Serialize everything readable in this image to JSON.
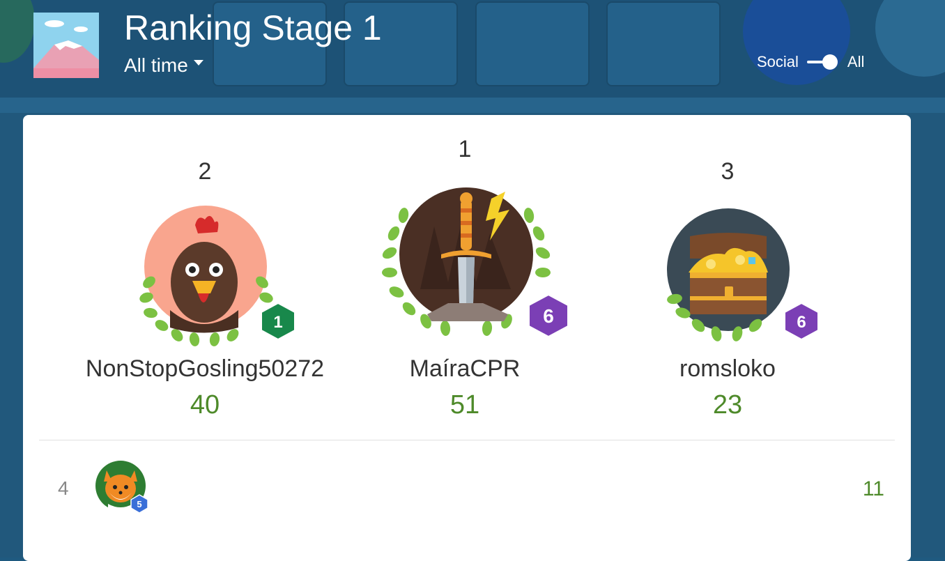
{
  "header": {
    "title": "Ranking Stage 1",
    "filter_label": "All time",
    "toggle_left_label": "Social",
    "toggle_right_label": "All",
    "toggle_state": "All"
  },
  "podium": [
    {
      "rank": "2",
      "name": "NonStopGosling50272",
      "score": "40",
      "level": "1",
      "badge_color": "#18884b",
      "avatar": "rooster-avatar"
    },
    {
      "rank": "1",
      "name": "MaíraCPR",
      "score": "51",
      "level": "6",
      "badge_color": "#7b3fb5",
      "avatar": "sword-avatar"
    },
    {
      "rank": "3",
      "name": "romsloko",
      "score": "23",
      "level": "6",
      "badge_color": "#7b3fb5",
      "avatar": "treasure-chest-avatar"
    }
  ],
  "list": [
    {
      "rank": "4",
      "score": "11",
      "level": "5",
      "badge_color": "#3a6fd8",
      "avatar": "fox-avatar"
    }
  ],
  "colors": {
    "score_green": "#4e8a2a",
    "laurel_green": "#7cc142",
    "background_blue": "#21587c"
  }
}
